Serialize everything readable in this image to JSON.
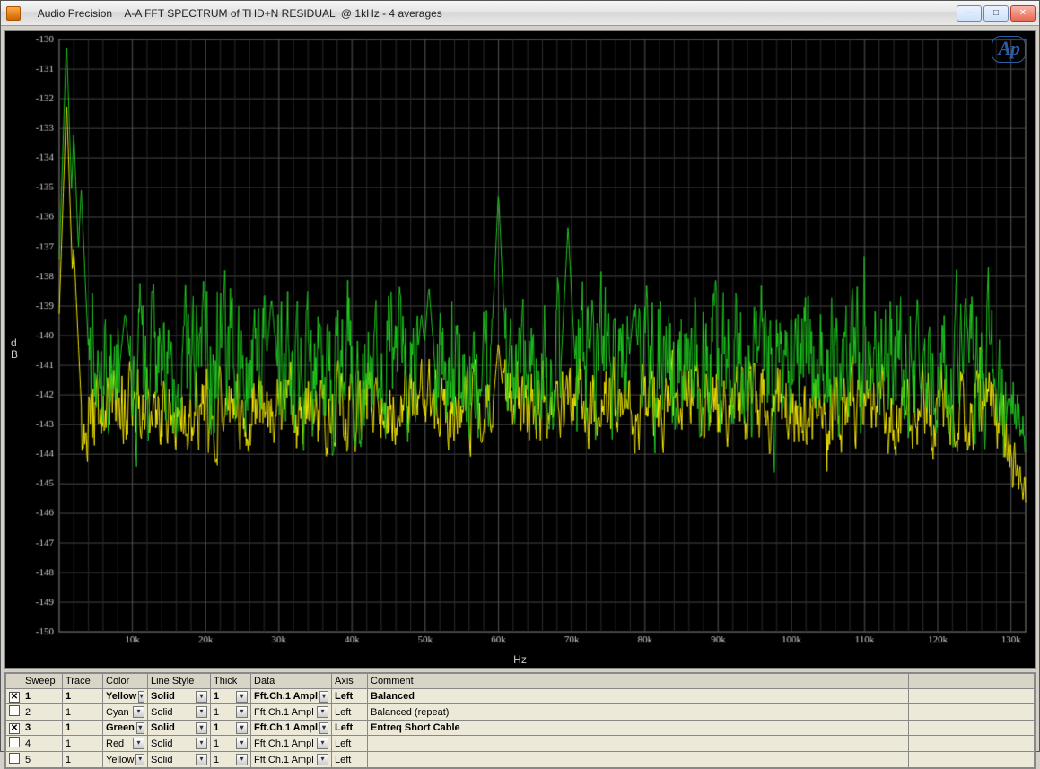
{
  "window": {
    "app_name": "Audio Precision",
    "subtitle": "A-A FFT SPECTRUM of THD+N RESIDUAL  @ 1kHz - 4 averages"
  },
  "logo_text": "Ap",
  "chart_data": {
    "type": "line",
    "xlabel": "Hz",
    "ylabel": "dB",
    "xlim": [
      0,
      132000
    ],
    "ylim": [
      -150,
      -130
    ],
    "xticks": [
      10000,
      20000,
      30000,
      40000,
      50000,
      60000,
      70000,
      80000,
      90000,
      100000,
      110000,
      120000,
      130000
    ],
    "xtick_labels": [
      "10k",
      "20k",
      "30k",
      "40k",
      "50k",
      "60k",
      "70k",
      "80k",
      "90k",
      "100k",
      "110k",
      "120k",
      "130k"
    ],
    "yticks": [
      -130,
      -131,
      -132,
      -133,
      -134,
      -135,
      -136,
      -137,
      -138,
      -139,
      -140,
      -141,
      -142,
      -143,
      -144,
      -145,
      -146,
      -147,
      -148,
      -149,
      -150
    ],
    "series": [
      {
        "name": "Entreq Short Cable",
        "color": "#1ec71e",
        "noise_center": -141,
        "noise_span": 2.5,
        "peaks": [
          {
            "x": 1000,
            "y": -130
          },
          {
            "x": 2000,
            "y": -133.1
          },
          {
            "x": 3000,
            "y": -135
          },
          {
            "x": 9000,
            "y": -139.2
          },
          {
            "x": 29000,
            "y": -138.7
          },
          {
            "x": 49500,
            "y": -139.3
          },
          {
            "x": 50500,
            "y": -138.3
          },
          {
            "x": 60000,
            "y": -135.1
          },
          {
            "x": 69500,
            "y": -136.3
          },
          {
            "x": 78500,
            "y": -139.0
          }
        ],
        "tail": {
          "from_x": 128000,
          "to_y": -143.5
        }
      },
      {
        "name": "Balanced",
        "color": "#f2e600",
        "noise_center": -142.4,
        "noise_span": 1.4,
        "peaks": [
          {
            "x": 1000,
            "y": -132
          },
          {
            "x": 2000,
            "y": -137
          },
          {
            "x": 60000,
            "y": -140.2
          }
        ],
        "tail": {
          "from_x": 128000,
          "to_y": -145.3
        }
      }
    ]
  },
  "legend": {
    "headers": [
      "",
      "Sweep",
      "Trace",
      "Color",
      "Line Style",
      "Thick",
      "Data",
      "Axis",
      "Comment"
    ],
    "rows": [
      {
        "active": true,
        "sweep": "1",
        "trace": "1",
        "color": "Yellow",
        "style": "Solid",
        "thick": "1",
        "data": "Fft.Ch.1 Ampl",
        "axis": "Left",
        "comment": "Balanced"
      },
      {
        "active": false,
        "sweep": "2",
        "trace": "1",
        "color": "Cyan",
        "style": "Solid",
        "thick": "1",
        "data": "Fft.Ch.1 Ampl",
        "axis": "Left",
        "comment": "Balanced (repeat)"
      },
      {
        "active": true,
        "sweep": "3",
        "trace": "1",
        "color": "Green",
        "style": "Solid",
        "thick": "1",
        "data": "Fft.Ch.1 Ampl",
        "axis": "Left",
        "comment": "Entreq Short Cable"
      },
      {
        "active": false,
        "sweep": "4",
        "trace": "1",
        "color": "Red",
        "style": "Solid",
        "thick": "1",
        "data": "Fft.Ch.1 Ampl",
        "axis": "Left",
        "comment": ""
      },
      {
        "active": false,
        "sweep": "5",
        "trace": "1",
        "color": "Yellow",
        "style": "Solid",
        "thick": "1",
        "data": "Fft.Ch.1 Ampl",
        "axis": "Left",
        "comment": ""
      }
    ]
  }
}
